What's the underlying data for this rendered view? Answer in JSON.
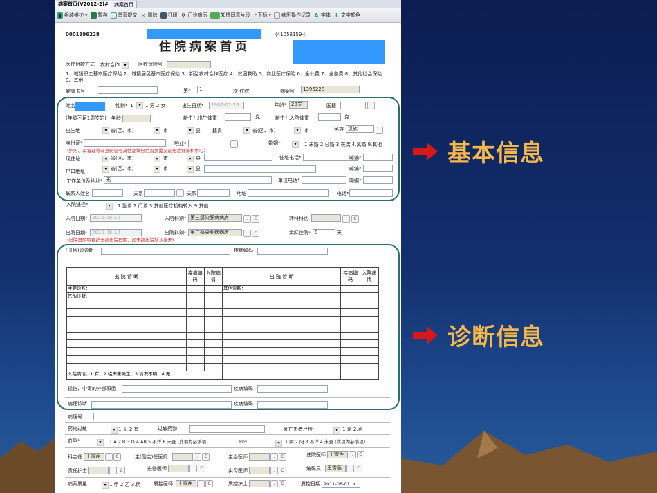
{
  "tabs": [
    "病案首页(V2012-2)#",
    "病案首页"
  ],
  "toolbar": [
    "组装维护",
    "暂存",
    "首页提交",
    "删除",
    "打印",
    "门诊病历",
    "知情同意片段",
    "上下标",
    "病历操作记录",
    "字体",
    "文字颜色"
  ],
  "header": {
    "record_no": "0001396228",
    "code": "(41058159-I)",
    "title": "住院病案首页"
  },
  "payment": {
    "label": "医疗付款方式",
    "value": "农村合作",
    "insurance_label": "医疗保险号",
    "options": "1、城镇职工基本医疗保险 2、城镇居民基本医疗保险 3、新型农村合作医疗 4、贫困救助 5、商业医疗保险 6、全公费 7、全自费 8、其他社会保险 9、其他"
  },
  "row_card": {
    "card_label": "健康卡号",
    "times_label": "第*",
    "times_value": "1",
    "times_suffix": "次 住院",
    "case_no_label": "病案号",
    "case_no": "1396228"
  },
  "basic": {
    "name_label": "姓名",
    "sex_label": "性别*",
    "sex_value": "1",
    "sex_options": "1.男 2.女",
    "birth_label": "出生日期*",
    "birth_value": "1987-01-26",
    "age_label": "年龄*",
    "age_value": "28岁",
    "nation_label": "国籍",
    "infant_label": "(年龄不足1周岁的)",
    "infant_age_label": "年龄",
    "nb_weight_label": "新生儿出生体重",
    "gram": "克",
    "nb_admit_weight_label": "新生儿入院体重",
    "birthplace_label": "出生地",
    "province": "省(区、市)",
    "city": "市",
    "county": "县",
    "native_label": "籍贯",
    "ethnic_label": "民族",
    "ethnic_value": "汉族",
    "id_label": "身份证*",
    "job_label": "职业*",
    "marriage_label": "婚姻*",
    "marriage_options": "1.未婚 2.已婚 3.丧偶 4.离婚 9.其他",
    "id_note": "(护照、军官证等非身份证号其他都填好后首页提交前电话计算机中心)",
    "address_label": "现住址",
    "home_phone_label": "住址电话*",
    "zip_label": "邮编*",
    "hukou_label": "户口地址",
    "work_label": "工作单位及地址*",
    "work_value": "无",
    "work_phone_label": "单位电话*",
    "contact_label": "联系人姓名",
    "relation_label": "关系",
    "contact_addr_label": "地址",
    "phone_label": "电话*"
  },
  "admit": {
    "route_label": "入院途径*",
    "route_options": "1.急诊 2.门诊 3.其他医疗机构转入 9.其他",
    "in_date_label": "入院日期*",
    "in_date": "2015-08-10",
    "in_dept_label": "入院科别*",
    "in_dept": "第三感染肝病病房",
    "transfer_label": "转科科别",
    "out_date_label": "出院日期*",
    "out_date": "2015-08-18",
    "out_dept_label": "出院科别*",
    "out_dept": "第三感染肝病病房",
    "days_label": "实际住院*",
    "days": "8",
    "day_unit": "天",
    "note": "(出院日期取自护士指出院日期，如未指出院默认当天)",
    "c": "C",
    "dot": "."
  },
  "diag": {
    "outpatient_label": "门(急)诊诊断",
    "code_label": "疾病编码",
    "col_diag": "出 院 诊 断",
    "col_code": "疾病编码",
    "col_cond": "入院病情",
    "main": "主要诊断：",
    "other": "其他诊断：",
    "other2": "其他诊断：",
    "legend": "入院病情：1.有，2.临床未确定，3.情况不明，4.无",
    "injury_label": "损伤、中毒的外部原因",
    "path_label": "病理诊断"
  },
  "misc": {
    "path_no_label": "病理号",
    "allergy_label": "药物过敏",
    "allergy_options": "1.无 2.有",
    "allergy_drug_label": "过敏药物",
    "autopsy_label": "死亡患者尸检",
    "autopsy_options": "1.是 2.否",
    "blood_label": "血型*",
    "blood_options": "1.A 2.B 3.O 4.AB 5.不详 6.未查 (此项为必填项)",
    "rh_label": "Rh*",
    "rh_options": "1.阴 2.阳 3.不详 4.未查 (此项为必填项)"
  },
  "staff": {
    "director": "科主任",
    "director_v": "王雪莲",
    "chief": "主(副主)任医师",
    "attending": "主治医师",
    "resident": "住院医师",
    "resident_v": "王雪莲",
    "nurse": "责任护士",
    "trainee": "进修医师",
    "intern": "实习医师",
    "coder": "编码员",
    "coder_v": "王雪莲",
    "quality": "病案质量",
    "quality_options": "1.甲 2.乙 3.丙",
    "qc_doctor": "质控医师",
    "qc_doctor_v": "王雪莲",
    "qc_nurse": "质控护士",
    "qc_date": "质控日期",
    "qc_date_v": "2011-08-01"
  },
  "side": {
    "basic": "基本信息",
    "diag": "诊断信息"
  },
  "colors": {
    "accent_label": "#f6b84a",
    "arrow": "#d81818",
    "frame": "#2d6e73"
  }
}
